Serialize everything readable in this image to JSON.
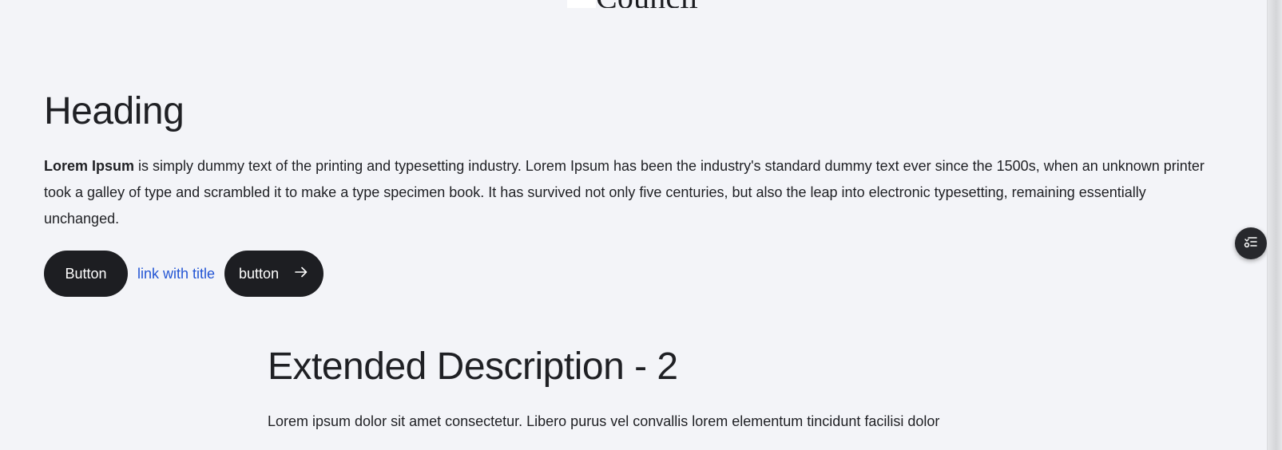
{
  "logo": {
    "text": "Council"
  },
  "hero": {
    "heading": "Heading",
    "body_bold": "Lorem Ipsum",
    "body_rest": " is simply dummy text of the printing and typesetting industry. Lorem Ipsum has been the industry's standard dummy text ever since the 1500s, when an unknown printer took a galley of type and scrambled it to make a type specimen book. It has survived not only five centuries, but also the leap into electronic typesetting, remaining essentially unchanged.",
    "button_label": "Button",
    "link_label": "link with title",
    "arrow_button_label": "button"
  },
  "extended": {
    "heading": "Extended Description - 2",
    "body": "Lorem ipsum dolor sit amet consectetur. Libero purus vel convallis lorem elementum tincidunt facilisi dolor"
  },
  "icons": {
    "arrow": "arrow-right-icon",
    "toc": "table-of-contents-icon"
  },
  "colors": {
    "background": "#f3f4f8",
    "button": "#1d1e22",
    "link": "#2355d4"
  }
}
